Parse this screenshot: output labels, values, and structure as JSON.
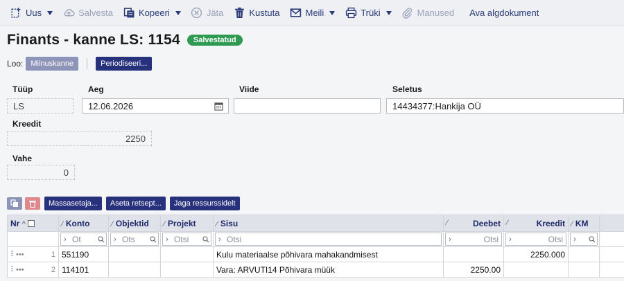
{
  "toolbar": {
    "uus": "Uus",
    "salvesta": "Salvesta",
    "kopeeri": "Kopeeri",
    "jata": "Jäta",
    "kustuta": "Kustuta",
    "meili": "Meili",
    "truki": "Trüki",
    "manused": "Manused",
    "ava": "Ava algdokument"
  },
  "header": {
    "title": "Finants - kanne LS: 1154",
    "status": "Salvestatud"
  },
  "loo": {
    "label": "Loo:",
    "miinuskanne": "Miinuskanne",
    "periodiseeri": "Periodiseeri..."
  },
  "form": {
    "tyyp_label": "Tüüp",
    "tyyp_value": "LS",
    "aeg_label": "Aeg",
    "aeg_value": "12.06.2026",
    "viide_label": "Viide",
    "viide_value": "",
    "seletus_label": "Seletus",
    "seletus_value": "14434377:Hankija OÜ",
    "kreedit_label": "Kreedit",
    "kreedit_value": "2250",
    "vahe_label": "Vahe",
    "vahe_value": "0"
  },
  "grid_tools": {
    "massasetaja": "Massasetaja...",
    "aseta": "Aseta retsept...",
    "jaga": "Jaga ressurssidelt"
  },
  "grid": {
    "headers": {
      "nr": "Nr",
      "konto": "Konto",
      "objektid": "Objektid",
      "projekt": "Projekt",
      "sisu": "Sisu",
      "deebet": "Deebet",
      "kreedit": "Kreedit",
      "km": "KM"
    },
    "filters": {
      "konto": "Otsi",
      "objektid": "Otsi",
      "projekt": "Otsi",
      "sisu": "Otsi",
      "deebet": "Otsi",
      "kreedit": "Otsi"
    },
    "rows": [
      {
        "nr": "1",
        "konto": "551190",
        "objektid": "",
        "projekt": "",
        "sisu": "Kulu materiaalse põhivara mahakandmisest",
        "deebet": "",
        "kreedit": "2250.000",
        "km": ""
      },
      {
        "nr": "2",
        "konto": "114101",
        "objektid": "",
        "projekt": "",
        "sisu": "Vara: ARVUTI14 Põhivara müük",
        "deebet": "2250.00",
        "kreedit": "",
        "km": ""
      }
    ]
  },
  "colors": {
    "navy": "#27317c",
    "status_green": "#2e9a52",
    "toolbar_text": "#2a3b78"
  }
}
